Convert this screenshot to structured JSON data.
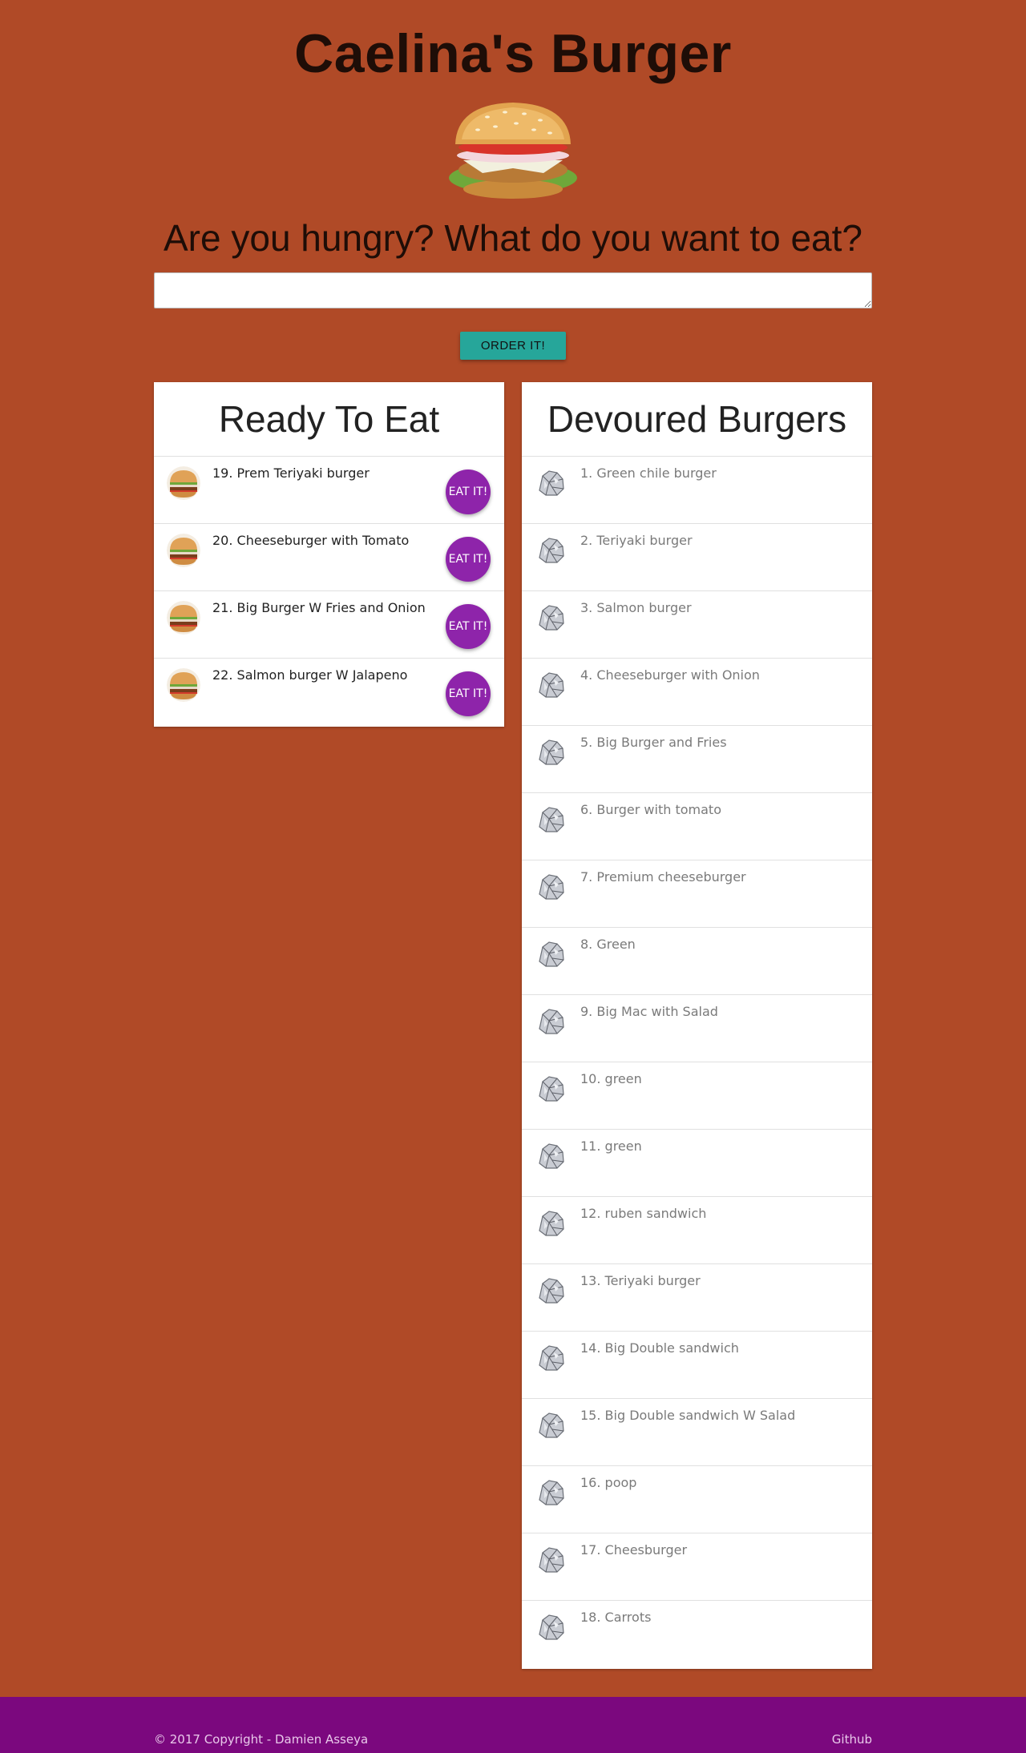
{
  "header": {
    "title": "Caelina's Burger",
    "question": "Are you hungry? What do you want to eat?"
  },
  "order_form": {
    "input_value": "",
    "button_label": "ORDER IT!"
  },
  "ready": {
    "heading": "Ready To Eat",
    "button_label": "EAT IT!",
    "items": [
      "19. Prem Teriyaki burger",
      "20. Cheeseburger with Tomato",
      "21. Big Burger W Fries and Onion",
      "22. Salmon burger W Jalapeno"
    ]
  },
  "devoured": {
    "heading": "Devoured Burgers",
    "items": [
      "1. Green chile burger",
      "2. Teriyaki burger",
      "3. Salmon burger",
      "4. Cheeseburger with Onion",
      "5. Big Burger and Fries",
      "6. Burger with tomato",
      "7. Premium cheeseburger",
      "8. Green",
      "9. Big Mac with Salad",
      "10. green",
      "11. green",
      "12. ruben sandwich",
      "13. Teriyaki burger",
      "14. Big Double sandwich",
      "15. Big Double sandwich W Salad",
      "16. poop",
      "17. Cheesburger",
      "18. Carrots"
    ]
  },
  "footer": {
    "copyright": "© 2017 Copyright - Damien Asseya",
    "github_link": "Github"
  },
  "colors": {
    "background": "#b04a27",
    "order_button": "#26a69a",
    "eat_button": "#8e24aa",
    "footer": "#7b087e"
  },
  "icons": {
    "hero": "burger-image",
    "ready_item": "burger-avatar",
    "devoured_item": "foil-wrapper-avatar"
  }
}
